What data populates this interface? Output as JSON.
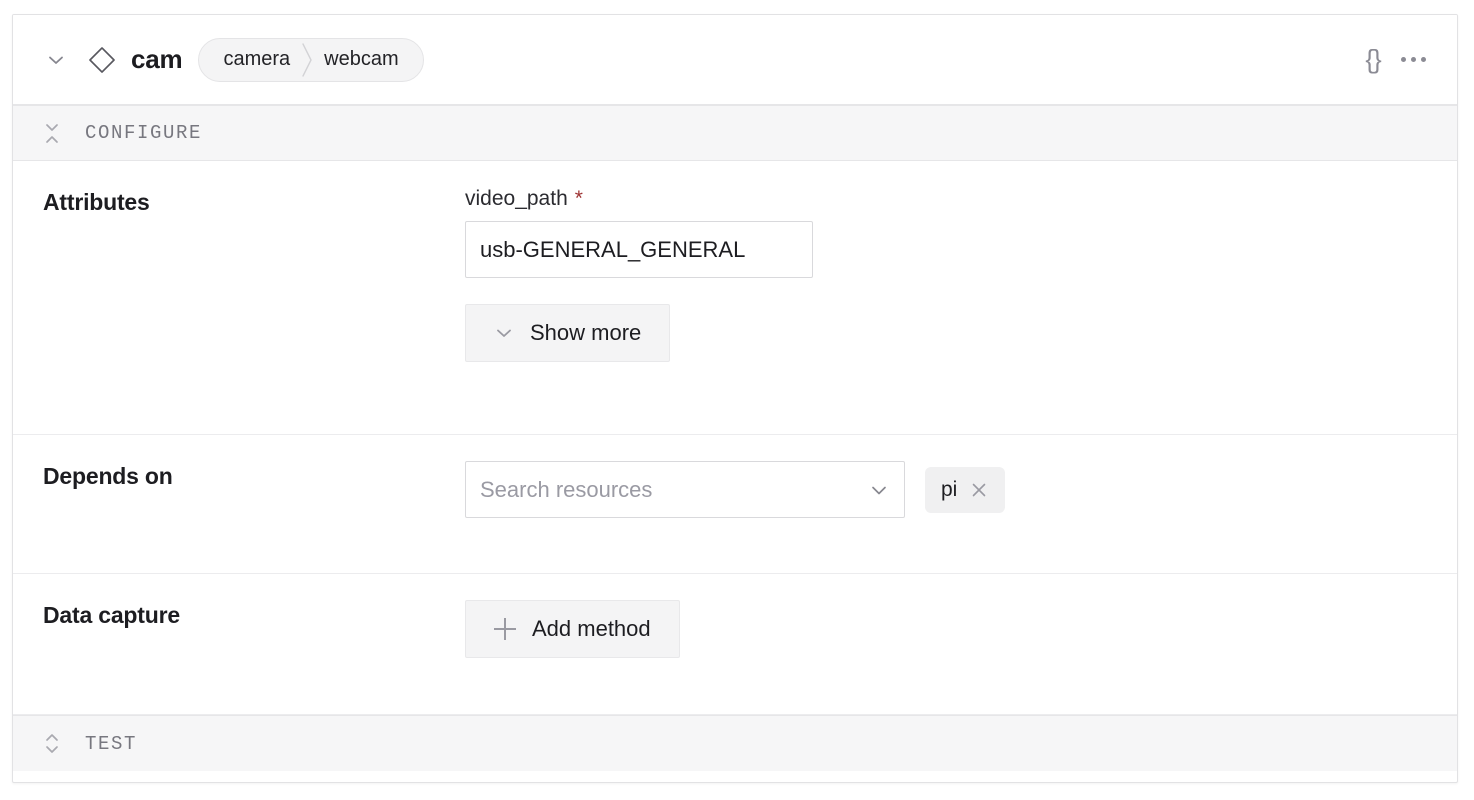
{
  "card": {
    "title": "cam",
    "collapse_toggle_icon": "chevron-down-icon",
    "resource_icon": "diamond-icon",
    "breadcrumb": {
      "type": "camera",
      "model": "webcam",
      "separator_icon": "chevron-right-icon"
    },
    "actions": {
      "json_label": "{}",
      "json_icon": "json-braces-icon",
      "overflow_icon": "more-horizontal-icon"
    }
  },
  "sections": {
    "configure": {
      "label": "CONFIGURE",
      "toggle_icon": "collapse-vertical-icon"
    },
    "test": {
      "label": "TEST",
      "toggle_icon": "expand-vertical-icon"
    }
  },
  "rows": {
    "attributes": {
      "label": "Attributes",
      "field": {
        "name": "video_path",
        "required_marker": "*",
        "value": "usb-GENERAL_GENERAL"
      },
      "show_more": {
        "label": "Show more",
        "icon": "chevron-down-icon"
      }
    },
    "depends_on": {
      "label": "Depends on",
      "select": {
        "placeholder": "Search resources",
        "icon": "chevron-down-icon"
      },
      "chips": [
        {
          "label": "pi",
          "remove_icon": "close-icon"
        }
      ]
    },
    "data_capture": {
      "label": "Data capture",
      "add_method": {
        "label": "Add method",
        "icon": "plus-icon"
      }
    }
  },
  "colors": {
    "card_border": "#e2e2e4",
    "section_bar_bg": "#f6f6f7",
    "section_label": "#77777f",
    "required_star": "#9e3333",
    "button_bg": "#f4f4f5",
    "placeholder": "#9a9aa3"
  }
}
